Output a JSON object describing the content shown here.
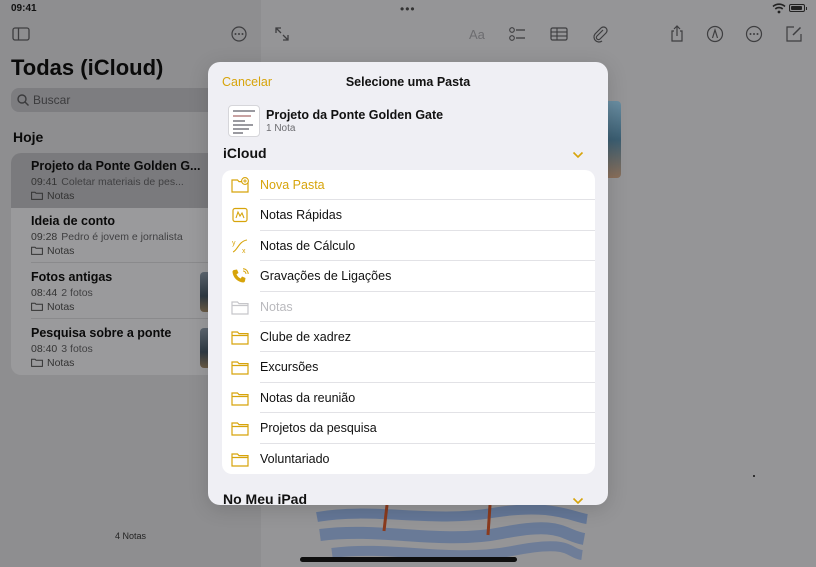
{
  "status": {
    "time": "09:41",
    "dots": "•••"
  },
  "sidebar": {
    "title": "Todas (iCloud)",
    "search_placeholder": "Buscar",
    "section": "Hoje",
    "notes": [
      {
        "title": "Projeto da Ponte Golden G...",
        "time": "09:41",
        "preview": "Coletar materiais de pes...",
        "folder": "Notas",
        "selected": true
      },
      {
        "title": "Ideia de conto",
        "time": "09:28",
        "preview": "Pedro é jovem e jornalista",
        "folder": "Notas"
      },
      {
        "title": "Fotos antigas",
        "time": "08:44",
        "preview": "2 fotos",
        "folder": "Notas"
      },
      {
        "title": "Pesquisa sobre a ponte",
        "time": "08:40",
        "preview": "3 fotos",
        "folder": "Notas"
      }
    ],
    "count": "4 Notas"
  },
  "toolbar": {
    "icons": [
      "sidebar-icon",
      "more-icon",
      "expand-icon",
      "format-text-icon",
      "checklist-icon",
      "table-icon",
      "attachment-icon",
      "share-icon",
      "markup-icon",
      "more-icon",
      "compose-icon"
    ]
  },
  "sheet": {
    "cancel": "Cancelar",
    "title": "Selecione uma Pasta",
    "source_note": {
      "name": "Projeto da Ponte Golden Gate",
      "count": "1 Nota"
    },
    "group_icloud": "iCloud",
    "group_ipad": "No Meu iPad",
    "folders": [
      {
        "label": "Nova Pasta",
        "icon": "new-folder-icon",
        "style": "accent"
      },
      {
        "label": "Notas Rápidas",
        "icon": "quick-notes-icon",
        "style": "normal"
      },
      {
        "label": "Notas de Cálculo",
        "icon": "math-notes-icon",
        "style": "normal"
      },
      {
        "label": "Gravações de Ligações",
        "icon": "call-recordings-icon",
        "style": "normal"
      },
      {
        "label": "Notas",
        "icon": "folder-icon",
        "style": "disabled"
      },
      {
        "label": "Clube de xadrez",
        "icon": "folder-icon",
        "style": "normal"
      },
      {
        "label": "Excursões",
        "icon": "folder-icon",
        "style": "normal"
      },
      {
        "label": "Notas da reunião",
        "icon": "folder-icon",
        "style": "normal"
      },
      {
        "label": "Projetos da pesquisa",
        "icon": "folder-icon",
        "style": "normal"
      },
      {
        "label": "Voluntariado",
        "icon": "folder-icon",
        "style": "normal"
      }
    ]
  },
  "colors": {
    "accent": "#d7a40b",
    "dim_background": "#8f8f91",
    "sheet_background": "#efeff4"
  }
}
